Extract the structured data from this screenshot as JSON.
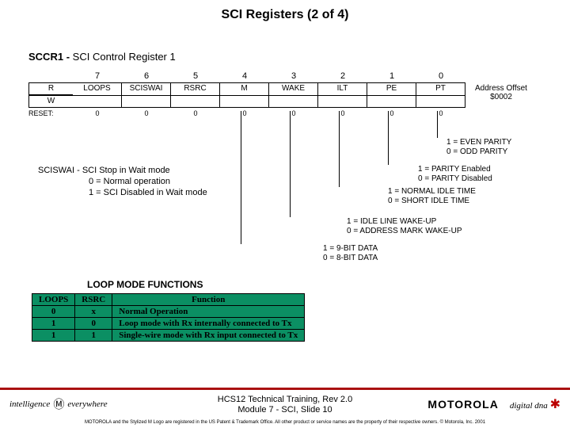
{
  "title": "SCI Registers (2 of 4)",
  "register": {
    "name_bold": "SCCR1",
    "dash": "-",
    "name_rest": "SCI Control Register 1",
    "bits": {
      "b7": "7",
      "b6": "6",
      "b5": "5",
      "b4": "4",
      "b3": "3",
      "b2": "2",
      "b1": "1",
      "b0": "0"
    },
    "r_label": "R",
    "w_label": "W",
    "reset_label": "RESET:",
    "fields": {
      "f7": "LOOPS",
      "f6": "SCISWAI",
      "f5": "RSRC",
      "f4": "M",
      "f3": "WAKE",
      "f2": "ILT",
      "f1": "PE",
      "f0": "PT"
    },
    "reset": {
      "r7": "0",
      "r6": "0",
      "r5": "0",
      "r4": "0",
      "r3": "0",
      "r2": "0",
      "r1": "0",
      "r0": "0"
    }
  },
  "address": {
    "line1": "Address Offset",
    "line2": "$0002"
  },
  "annotations": {
    "pt1": "1 = EVEN PARITY",
    "pt0": "0 = ODD PARITY",
    "pe1": "1 = PARITY Enabled",
    "pe0": "0 = PARITY Disabled",
    "ilt1": "1 = NORMAL IDLE TIME",
    "ilt0": "0 = SHORT IDLE TIME",
    "wake1": "1 = IDLE LINE WAKE-UP",
    "wake0": "0 = ADDRESS MARK WAKE-UP",
    "m1": "1 = 9-BIT DATA",
    "m0": "0 = 8-BIT DATA"
  },
  "sciswai": {
    "l1": "SCISWAI - SCI Stop in Wait mode",
    "l2": "0 = Normal operation",
    "l3": "1 = SCI Disabled in Wait mode"
  },
  "loop": {
    "title": "LOOP MODE FUNCTIONS",
    "h1": "LOOPS",
    "h2": "RSRC",
    "h3": "Function",
    "rows": [
      {
        "c1": "0",
        "c2": "x",
        "c3": "Normal Operation"
      },
      {
        "c1": "1",
        "c2": "0",
        "c3": "Loop mode with Rx internally connected to Tx"
      },
      {
        "c1": "1",
        "c2": "1",
        "c3": "Single-wire mode with Rx input connected to Tx"
      }
    ]
  },
  "footer": {
    "l1": "HCS12 Technical Training,  Rev 2.0",
    "l2": "Module 7 - SCI, Slide 10",
    "leftbrand_1": "intelligence",
    "leftbrand_2": "everywhere",
    "moto": "MOTOROLA",
    "dd": "digital dna",
    "tiny": "MOTOROLA and the Stylized M Logo are registered in the US Patent & Trademark Office. All other product or service names are the property of their respective owners.  © Motorola, Inc. 2001"
  }
}
